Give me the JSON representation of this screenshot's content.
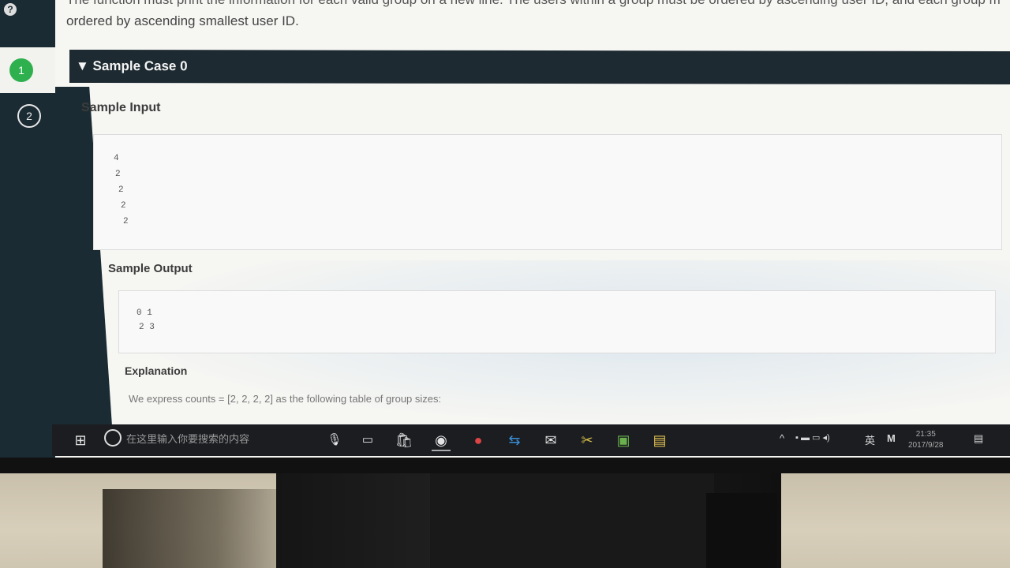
{
  "page": {
    "intro_line1": "The function must print the information for each valid group on a new line. The users within a group must be ordered by ascending user ID, and each group m",
    "intro_line2": "ordered by ascending smallest user ID."
  },
  "steps": [
    {
      "label": "1"
    },
    {
      "label": "2"
    }
  ],
  "help_icon": "?",
  "sample_case": {
    "header": "▼ Sample Case 0",
    "input_label": "Sample Input",
    "input_lines": [
      "4",
      "2",
      "2",
      "2",
      "2"
    ],
    "output_label": "Sample Output",
    "output_lines": [
      "0 1",
      "2 3"
    ],
    "explanation_label": "Explanation",
    "explanation_text": "We express counts = [2, 2, 2, 2] as the following table of group sizes:"
  },
  "taskbar": {
    "search_placeholder": "在这里输入你要搜索的内容",
    "icons": [
      "windows-start-icon",
      "cortana-icon",
      "microphone-icon",
      "task-view-icon",
      "store-icon",
      "chrome-icon",
      "app-red-icon",
      "teamviewer-icon",
      "mail-icon",
      "tools-icon",
      "photos-icon",
      "file-explorer-icon"
    ],
    "ime": "英",
    "time": "21:35",
    "date": "2017/9/28"
  },
  "colors": {
    "sidebar": "#1b2b33",
    "active_step": "#2eb04f",
    "header_bar": "#1d2a31",
    "taskbar": "#1b1d21"
  }
}
